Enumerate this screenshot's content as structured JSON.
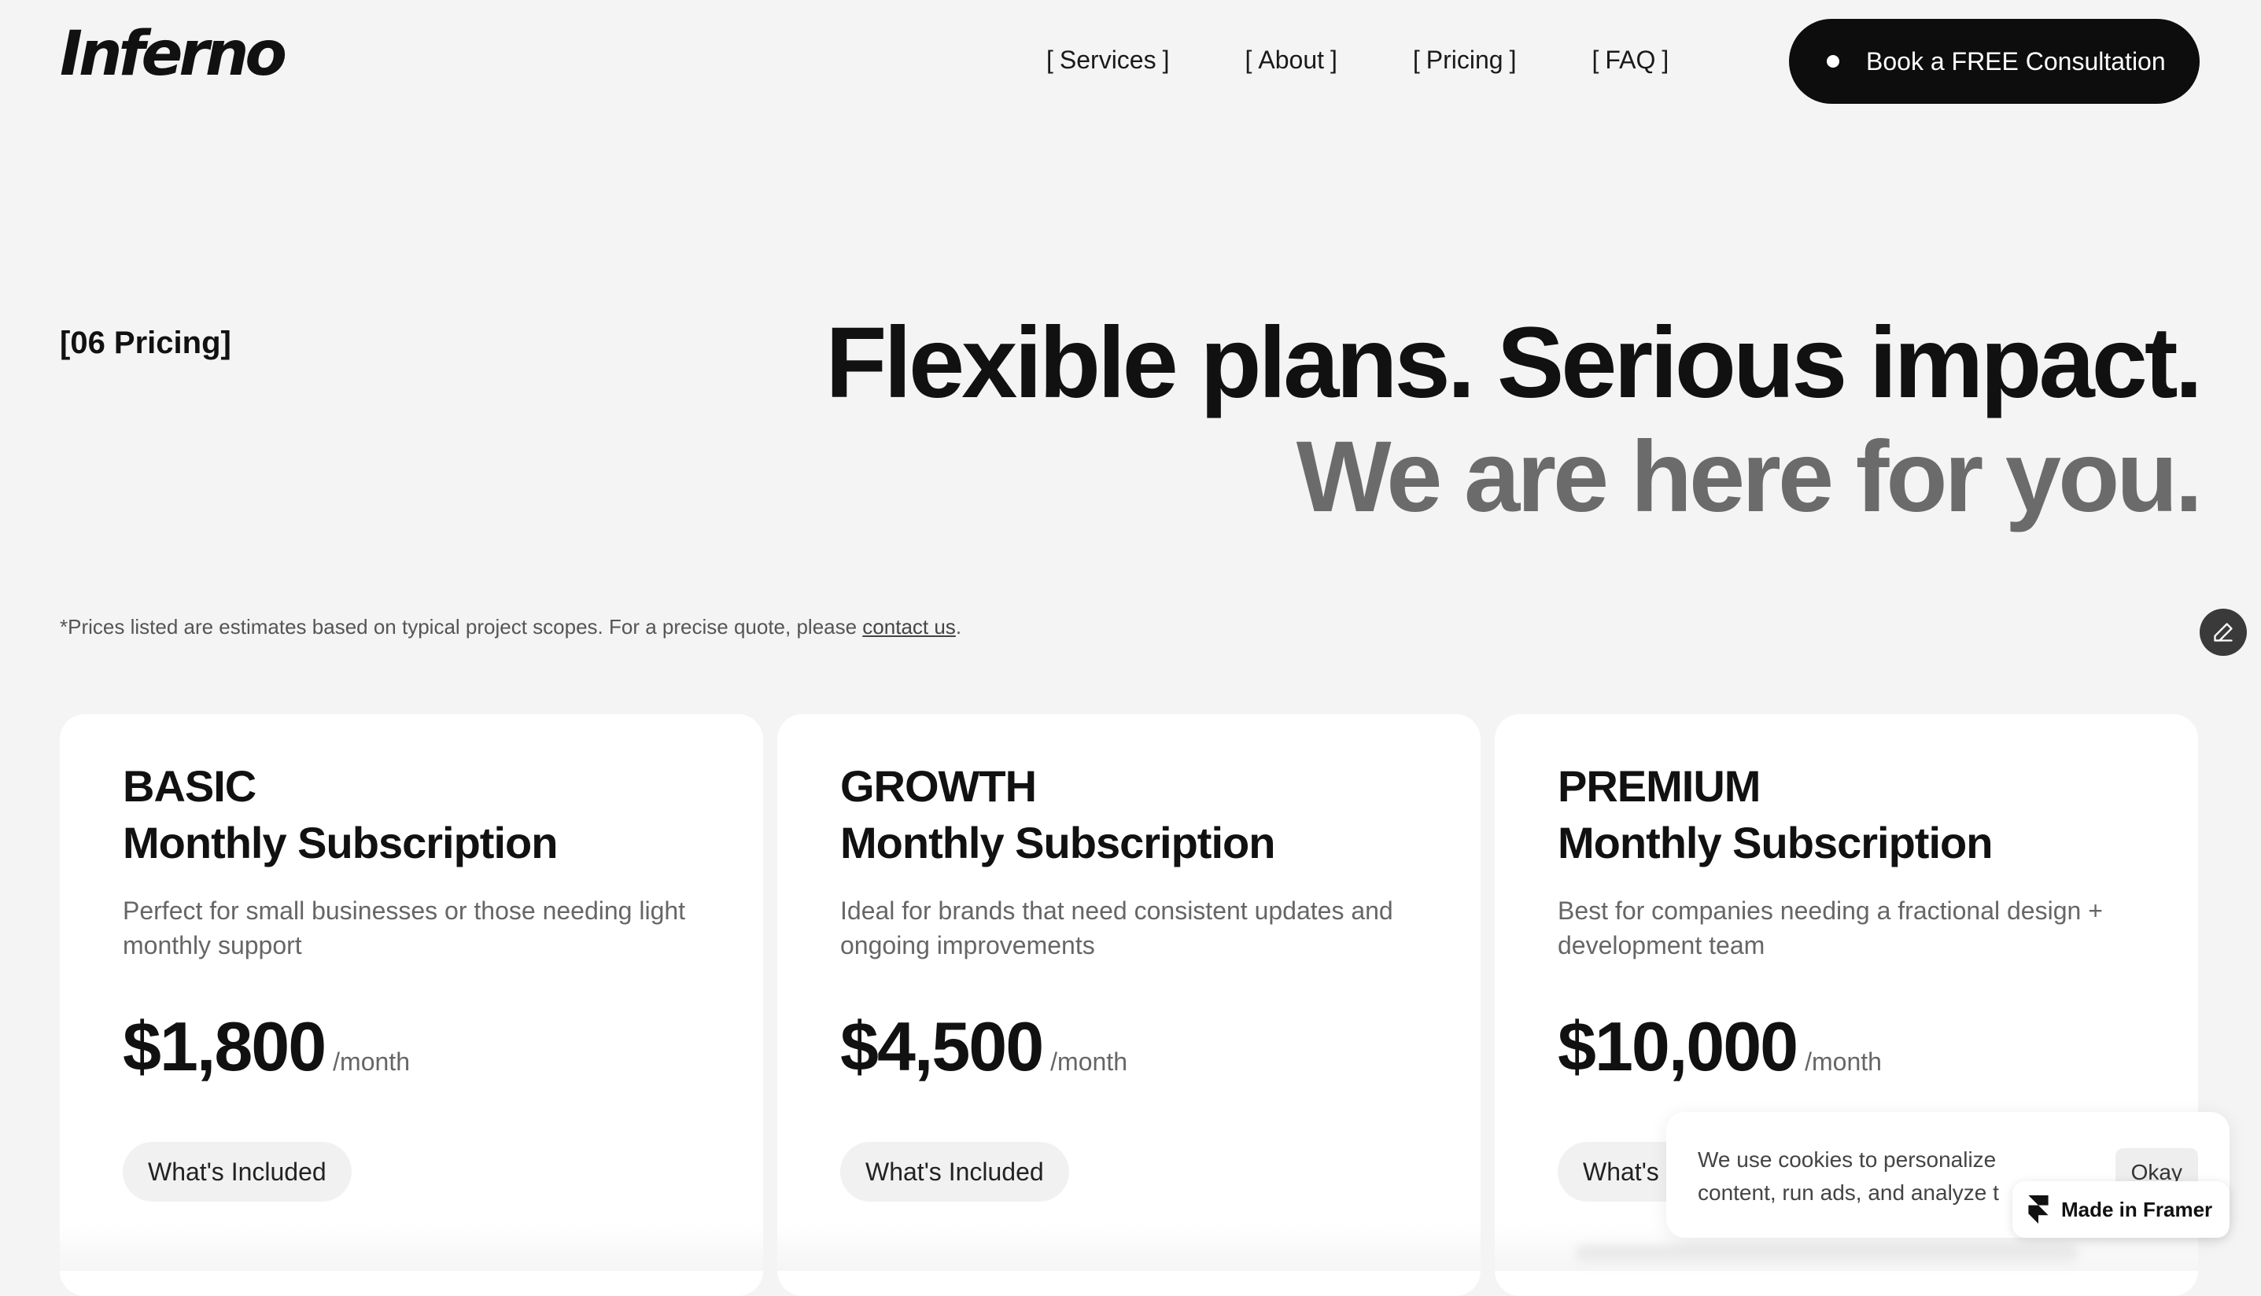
{
  "brand": {
    "logo_text": "Inferno"
  },
  "nav": {
    "items": [
      {
        "label": "Services"
      },
      {
        "label": "About"
      },
      {
        "label": "Pricing"
      },
      {
        "label": "FAQ"
      }
    ],
    "bracket_open": "[",
    "bracket_close": "]"
  },
  "cta": {
    "label": "Book a FREE Consultation"
  },
  "section": {
    "label": "[06 Pricing]",
    "headline_line1": "Flexible plans. Serious impact.",
    "headline_line2": "We are here for you."
  },
  "disclaimer": {
    "text": "*Prices listed are estimates based on typical project scopes. For a precise quote, please ",
    "link": "contact us",
    "end": "."
  },
  "plans": [
    {
      "tier": "BASIC",
      "subtitle": "Monthly Subscription",
      "description": "Perfect for small businesses or those needing light monthly support",
      "price": "$1,800",
      "period": "/month",
      "button": "What's Included"
    },
    {
      "tier": "GROWTH",
      "subtitle": "Monthly Subscription",
      "description": "Ideal for brands that need consistent updates and ongoing improvements",
      "price": "$4,500",
      "period": "/month",
      "button": "What's Included"
    },
    {
      "tier": "PREMIUM",
      "subtitle": "Monthly Subscription",
      "description": "Best for companies needing a fractional design + development team",
      "price": "$10,000",
      "period": "/month",
      "button": "What's Included"
    }
  ],
  "cookie": {
    "text_line1": "We use cookies to personalize",
    "text_line2": "content, run ads, and analyze t",
    "okay": "Okay"
  },
  "framer_badge": {
    "label": "Made in Framer",
    "icon": "framer-icon"
  },
  "colors": {
    "background": "#f3f4f3",
    "primary": "#0d0d0d",
    "muted_heading": "#6b6b6b",
    "card": "#ffffff"
  }
}
